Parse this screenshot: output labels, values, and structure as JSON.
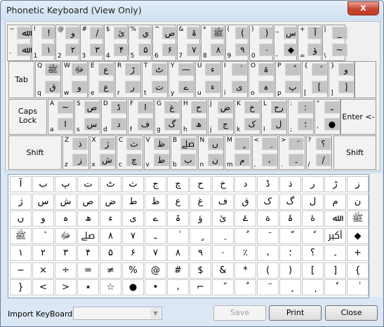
{
  "window": {
    "title": "Phonetic Keyboard (View Only)",
    "close_glyph": "x"
  },
  "keyboard": {
    "rows": [
      [
        {
          "id": "backtick",
          "ls": "~",
          "ll": "`",
          "u": "ﷲ",
          "d": "ﷲ"
        },
        {
          "id": "1",
          "ls": "!",
          "ll": "1",
          "u": "!",
          "d": "۱"
        },
        {
          "id": "2",
          "ls": "@",
          "ll": "2",
          "u": "ﻭ",
          "d": "۲"
        },
        {
          "id": "3",
          "ls": "#",
          "ll": "3",
          "u": "/",
          "d": "۳"
        },
        {
          "id": "4",
          "ls": "$",
          "ll": "4",
          "u": "ئ",
          "d": "۴"
        },
        {
          "id": "5",
          "ls": "%",
          "ll": "5",
          "u": "ي",
          "d": "۵"
        },
        {
          "id": "6",
          "ls": "^",
          "ll": "6",
          "u": "ص",
          "d": "۶"
        },
        {
          "id": "7",
          "ls": "&",
          "ll": "7",
          "u": "ۂ",
          "d": "۷"
        },
        {
          "id": "8",
          "ls": "*",
          "ll": "8",
          "u": "ﷺ",
          "d": "۸"
        },
        {
          "id": "9",
          "ls": "(",
          "ll": "9",
          "u": "(",
          "d": "۹"
        },
        {
          "id": "0",
          "ls": ")",
          "ll": "0",
          "u": ")",
          "d": "۰"
        },
        {
          "id": "minus",
          "ls": "_",
          "ll": "-",
          "u": "ﺱ",
          "d": "◆"
        },
        {
          "id": "equals",
          "ls": "+",
          "ll": "=",
          "u": "آ",
          "d": "ؤ"
        },
        {
          "id": "backslash",
          "ls": "|",
          "ll": "\\",
          "u": "_",
          "d": "~"
        }
      ],
      [
        {
          "id": "q",
          "ls": "Q",
          "ll": "q",
          "u": "ﷺ",
          "d": "ق"
        },
        {
          "id": "w",
          "ls": "W",
          "ll": "w",
          "u": "ﷻ",
          "d": "و"
        },
        {
          "id": "e",
          "ls": "E",
          "ll": "e",
          "u": "ع",
          "d": "ع"
        },
        {
          "id": "r",
          "ls": "R",
          "ll": "r",
          "u": "ڑ",
          "d": "ر"
        },
        {
          "id": "t",
          "ls": "T",
          "ll": "t",
          "u": "ٹ",
          "d": "ت"
        },
        {
          "id": "y",
          "ls": "Y",
          "ll": "y",
          "u": "—",
          "d": "ے"
        },
        {
          "id": "u",
          "ls": "U",
          "ll": "u",
          "u": "ء",
          "d": "ء"
        },
        {
          "id": "i",
          "ls": "I",
          "ll": "i",
          "u": "ٰ",
          "d": "ی"
        },
        {
          "id": "o",
          "ls": "O",
          "ll": "o",
          "u": "ۃ",
          "d": "ہ"
        },
        {
          "id": "p",
          "ls": "P",
          "ll": "p",
          "u": "ُ",
          "d": "پ"
        },
        {
          "id": "lbracket",
          "ls": "{",
          "ll": "[",
          "u": "ٔ",
          "d": "["
        },
        {
          "id": "rbracket",
          "ls": "}",
          "ll": "]",
          "u": "ﻭ",
          "d": "]"
        }
      ],
      [
        {
          "id": "a",
          "ls": "A",
          "ll": "a",
          "u": "~",
          "d": "ا"
        },
        {
          "id": "s",
          "ls": "S",
          "ll": "s",
          "u": "ص",
          "d": "س"
        },
        {
          "id": "d",
          "ls": "D",
          "ll": "d",
          "u": "ڈ",
          "d": "د"
        },
        {
          "id": "f",
          "ls": "F",
          "ll": "f",
          "u": "ا",
          "d": "ف"
        },
        {
          "id": "g",
          "ls": "G",
          "ll": "g",
          "u": "غ",
          "d": "گ"
        },
        {
          "id": "h",
          "ls": "H",
          "ll": "h",
          "u": "ح",
          "d": "ھ"
        },
        {
          "id": "j",
          "ls": "J",
          "ll": "j",
          "u": "ض",
          "d": "ج"
        },
        {
          "id": "k",
          "ls": "K",
          "ll": "k",
          "u": "خ",
          "d": "ک"
        },
        {
          "id": "l",
          "ls": "L",
          "ll": "l",
          "u": "رح",
          "d": "ل"
        },
        {
          "id": "semicolon",
          "ls": ":",
          "ll": ";",
          "u": ":",
          "d": "؛"
        },
        {
          "id": "quote",
          "ls": "\"",
          "ll": "'",
          "u": "ـ",
          "d": "●"
        }
      ],
      [
        {
          "id": "z",
          "ls": "Z",
          "ll": "z",
          "u": "ذ",
          "d": "ز"
        },
        {
          "id": "x",
          "ls": "X",
          "ll": "x",
          "u": "ژ",
          "d": "ش"
        },
        {
          "id": "c",
          "ls": "C",
          "ll": "c",
          "u": "ث",
          "d": "چ"
        },
        {
          "id": "v",
          "ls": "V",
          "ll": "v",
          "u": "ظ",
          "d": "ط"
        },
        {
          "id": "b",
          "ls": "B",
          "ll": "b",
          "u": "ﷰ",
          "d": "ب"
        },
        {
          "id": "n",
          "ls": "N",
          "ll": "n",
          "u": "ں",
          "d": "ن"
        },
        {
          "id": "m",
          "ls": "M",
          "ll": "m",
          "u": "ٍ",
          "d": "م"
        },
        {
          "id": "comma",
          "ls": "<",
          "ll": ",",
          "u": "ِ",
          "d": "،"
        },
        {
          "id": "period",
          "ls": ">",
          "ll": ".",
          "u": "َ",
          "d": "۔"
        },
        {
          "id": "slash",
          "ls": "?",
          "ll": "/",
          "u": "؟",
          "d": "/"
        }
      ]
    ],
    "special": {
      "tab": "Tab",
      "caps": "Caps\nLock",
      "enter": "Enter <-",
      "shift_left": "Shift",
      "shift_right": "Shift"
    }
  },
  "char_grid": [
    [
      "آ",
      "ب",
      "پ",
      "ت",
      "ٹ",
      "ث",
      "ج",
      "چ",
      "ح",
      "خ",
      "د",
      "ڈ",
      "ذ",
      "ر",
      "ڑ",
      "ز"
    ],
    [
      "ژ",
      "س",
      "ش",
      "ص",
      "ض",
      "ط",
      "ظ",
      "ع",
      "غ",
      "ف",
      "ق",
      "ک",
      "گ",
      "ل",
      "م",
      "ن"
    ],
    [
      "ں",
      "و",
      "ہ",
      "ھ",
      "ء",
      "ی",
      "ے",
      "ۃ",
      "ؤ",
      "ئ",
      "ۓ",
      "ة",
      "ۂ",
      "ۀ",
      "ﷲ",
      "ﷺ"
    ],
    [
      "ﷺ",
      "ٔ",
      "ﷻ",
      "ﷰ",
      "٨",
      "٧",
      "ـ",
      "ٰ",
      "ٍ",
      "ِ",
      "ُ",
      "َ",
      "ّ",
      "ٗ",
      "ﷳ",
      "◆"
    ],
    [
      "۱",
      "۲",
      "۳",
      "۴",
      "۵",
      "۶",
      "۷",
      "۸",
      "۹",
      "۰",
      "٪",
      "،",
      "؛",
      "؟",
      "۔",
      "+"
    ],
    [
      "−",
      "×",
      "÷",
      "=",
      "≠",
      "%",
      "@",
      "#",
      "$",
      "&",
      "*",
      "(",
      ")",
      "[",
      "]",
      "{"
    ],
    [
      "}",
      "<",
      ">",
      "٭",
      "☆",
      "●",
      "•",
      "،",
      "⌐",
      "ً",
      "ٌ",
      "ٓ",
      "ٕ",
      "ٖ",
      "ٗ",
      "ٰ"
    ]
  ],
  "footer": {
    "import_label": "Import KeyBoard:",
    "import_value": "",
    "save_label": "Save",
    "print_label": "Print",
    "close_label": "Close"
  }
}
